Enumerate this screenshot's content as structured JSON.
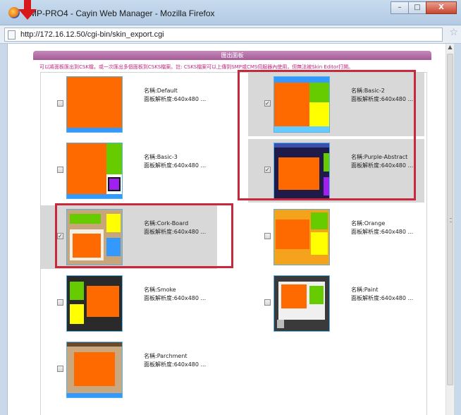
{
  "window": {
    "title": "SMP-PRO4 - Cayin Web Manager - Mozilla Firefox",
    "minimize": "–",
    "maximize": "□",
    "close": "X"
  },
  "address": {
    "url": "http://172.16.12.50/cgi-bin/skin_export.cgi"
  },
  "page": {
    "header": "匯出面板",
    "note": "可以將面板匯出到CSK檔，或一次匯出多個面板到CSKS檔案。註: CSKS檔案可以上傳到SMP或CMS伺服器內使用，但無法被Skin Editor打開。"
  },
  "skins": [
    {
      "name": "名稱:Default",
      "res": "面板解析度:640x480 ...",
      "checked": false,
      "check_mark": ""
    },
    {
      "name": "名稱:Basic-2",
      "res": "面板解析度:640x480 ...",
      "checked": true,
      "check_mark": "✓"
    },
    {
      "name": "名稱:Basic-3",
      "res": "面板解析度:640x480 ...",
      "checked": false,
      "check_mark": ""
    },
    {
      "name": "名稱:Purple-Abstract",
      "res": "面板解析度:640x480 ...",
      "checked": true,
      "check_mark": "✓"
    },
    {
      "name": "名稱:Cork-Board",
      "res": "面板解析度:640x480 ...",
      "checked": true,
      "check_mark": "✓"
    },
    {
      "name": "名稱:Orange",
      "res": "面板解析度:640x480 ...",
      "checked": false,
      "check_mark": ""
    },
    {
      "name": "名稱:Smoke",
      "res": "面板解析度:640x480 ...",
      "checked": false,
      "check_mark": ""
    },
    {
      "name": "名稱:Paint",
      "res": "面板解析度:640x480 ...",
      "checked": false,
      "check_mark": ""
    },
    {
      "name": "名稱:Parchment",
      "res": "面板解析度:640x480 ...",
      "checked": false,
      "check_mark": ""
    }
  ],
  "colors": {
    "header": "#a45a96",
    "note": "#c0267e",
    "highlight": "#c8283c",
    "selected_bg": "#d8d8d8"
  }
}
